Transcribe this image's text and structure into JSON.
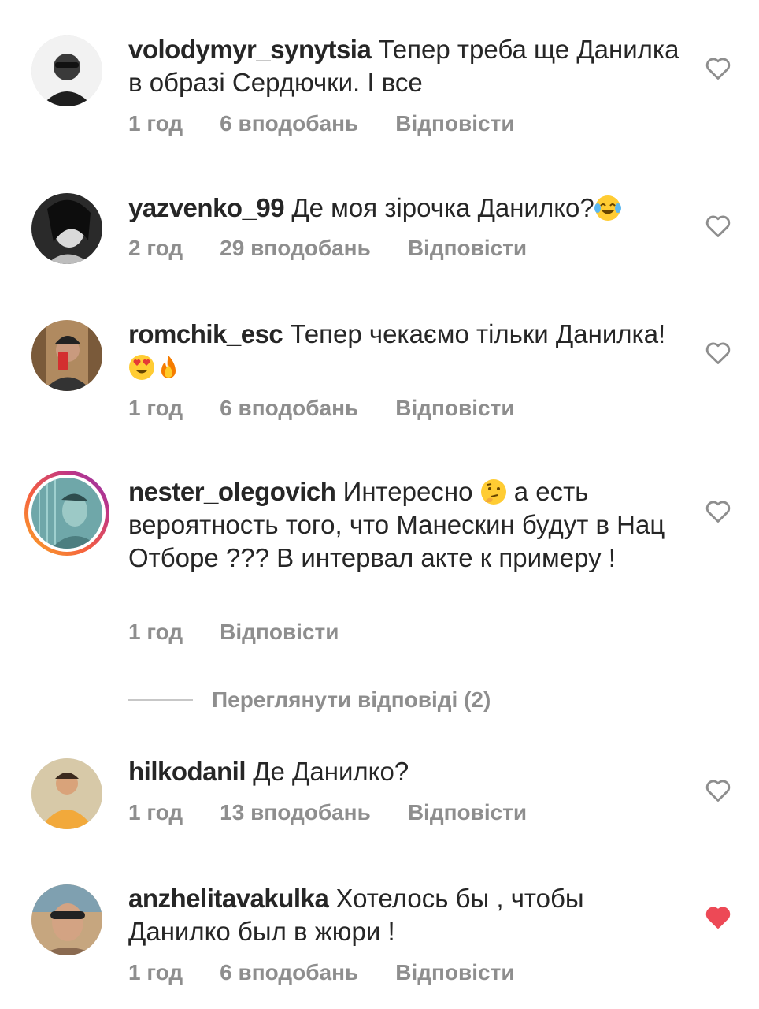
{
  "comments": [
    {
      "username": "volodymyr_synytsia",
      "text": "Тепер треба ще Данилка в образі Сердючки. І все",
      "time": "1 год",
      "likes": "6 вподобань",
      "reply": "Відповісти",
      "liked": false
    },
    {
      "username": "yazvenko_99",
      "text": "Де моя зірочка Данилко?",
      "emoji": [
        "face-tears-of-joy-emoji"
      ],
      "time": "2 год",
      "likes": "29 вподобань",
      "reply": "Відповісти",
      "liked": false
    },
    {
      "username": "romchik_esc",
      "text": "Тепер чекаємо тільки Данилка!",
      "emoji": [
        "heart-eyes-emoji",
        "fire-emoji"
      ],
      "time": "1 год",
      "likes": "6 вподобань",
      "reply": "Відповісти",
      "liked": false
    },
    {
      "username": "nester_olegovich",
      "text_before_emoji": "Интересно",
      "text_after_emoji": "а есть вероятность того, что Манескин будут в Нац Отборе ??? В интервал акте к примеру !",
      "emoji": [
        "thinking-face-emoji"
      ],
      "time": "1 год",
      "reply": "Відповісти",
      "liked": false,
      "view_replies": "Переглянути відповіді (2)"
    },
    {
      "username": "hilkodanil",
      "text": "Де Данилко?",
      "time": "1 год",
      "likes": "13 вподобань",
      "reply": "Відповісти",
      "liked": false
    },
    {
      "username": "anzhelitavakulka",
      "text": "Хотелось бы , чтобы Данилко был в жюри !",
      "time": "1 год",
      "likes": "6 вподобань",
      "reply": "Відповісти",
      "liked": true
    }
  ],
  "colors": {
    "text": "#262626",
    "meta": "#8e8e8e",
    "heart_outline": "#8e8e8e",
    "heart_liked": "#ed4956"
  },
  "icons": {
    "like": "heart-icon",
    "liked": "heart-filled-icon"
  }
}
